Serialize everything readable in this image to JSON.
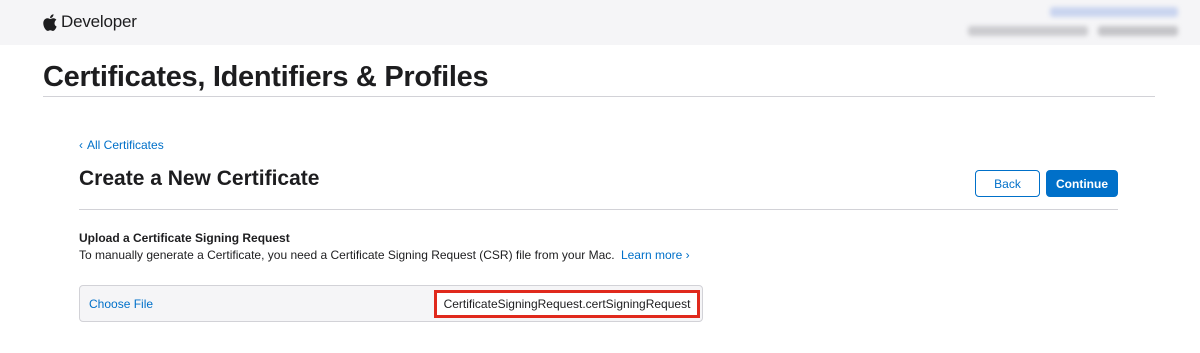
{
  "header": {
    "brand_text": "Developer",
    "brand_icon": "apple-logo-icon",
    "account_redacted": true
  },
  "page": {
    "title": "Certificates, Identifiers & Profiles"
  },
  "main": {
    "back_link_chevron": "‹",
    "back_link_label": "All Certificates",
    "section_title": "Create a New Certificate",
    "back_button_label": "Back",
    "continue_button_label": "Continue",
    "upload": {
      "heading": "Upload a Certificate Signing Request",
      "description": "To manually generate a Certificate, you need a Certificate Signing Request (CSR) file from your Mac.",
      "learn_more_label": "Learn more ›",
      "choose_file_label": "Choose File",
      "selected_file": "CertificateSigningRequest.certSigningRequest"
    }
  },
  "colors": {
    "link_blue": "#0070c9",
    "highlight_red": "#e0291c",
    "header_bg": "#f5f5f7"
  }
}
